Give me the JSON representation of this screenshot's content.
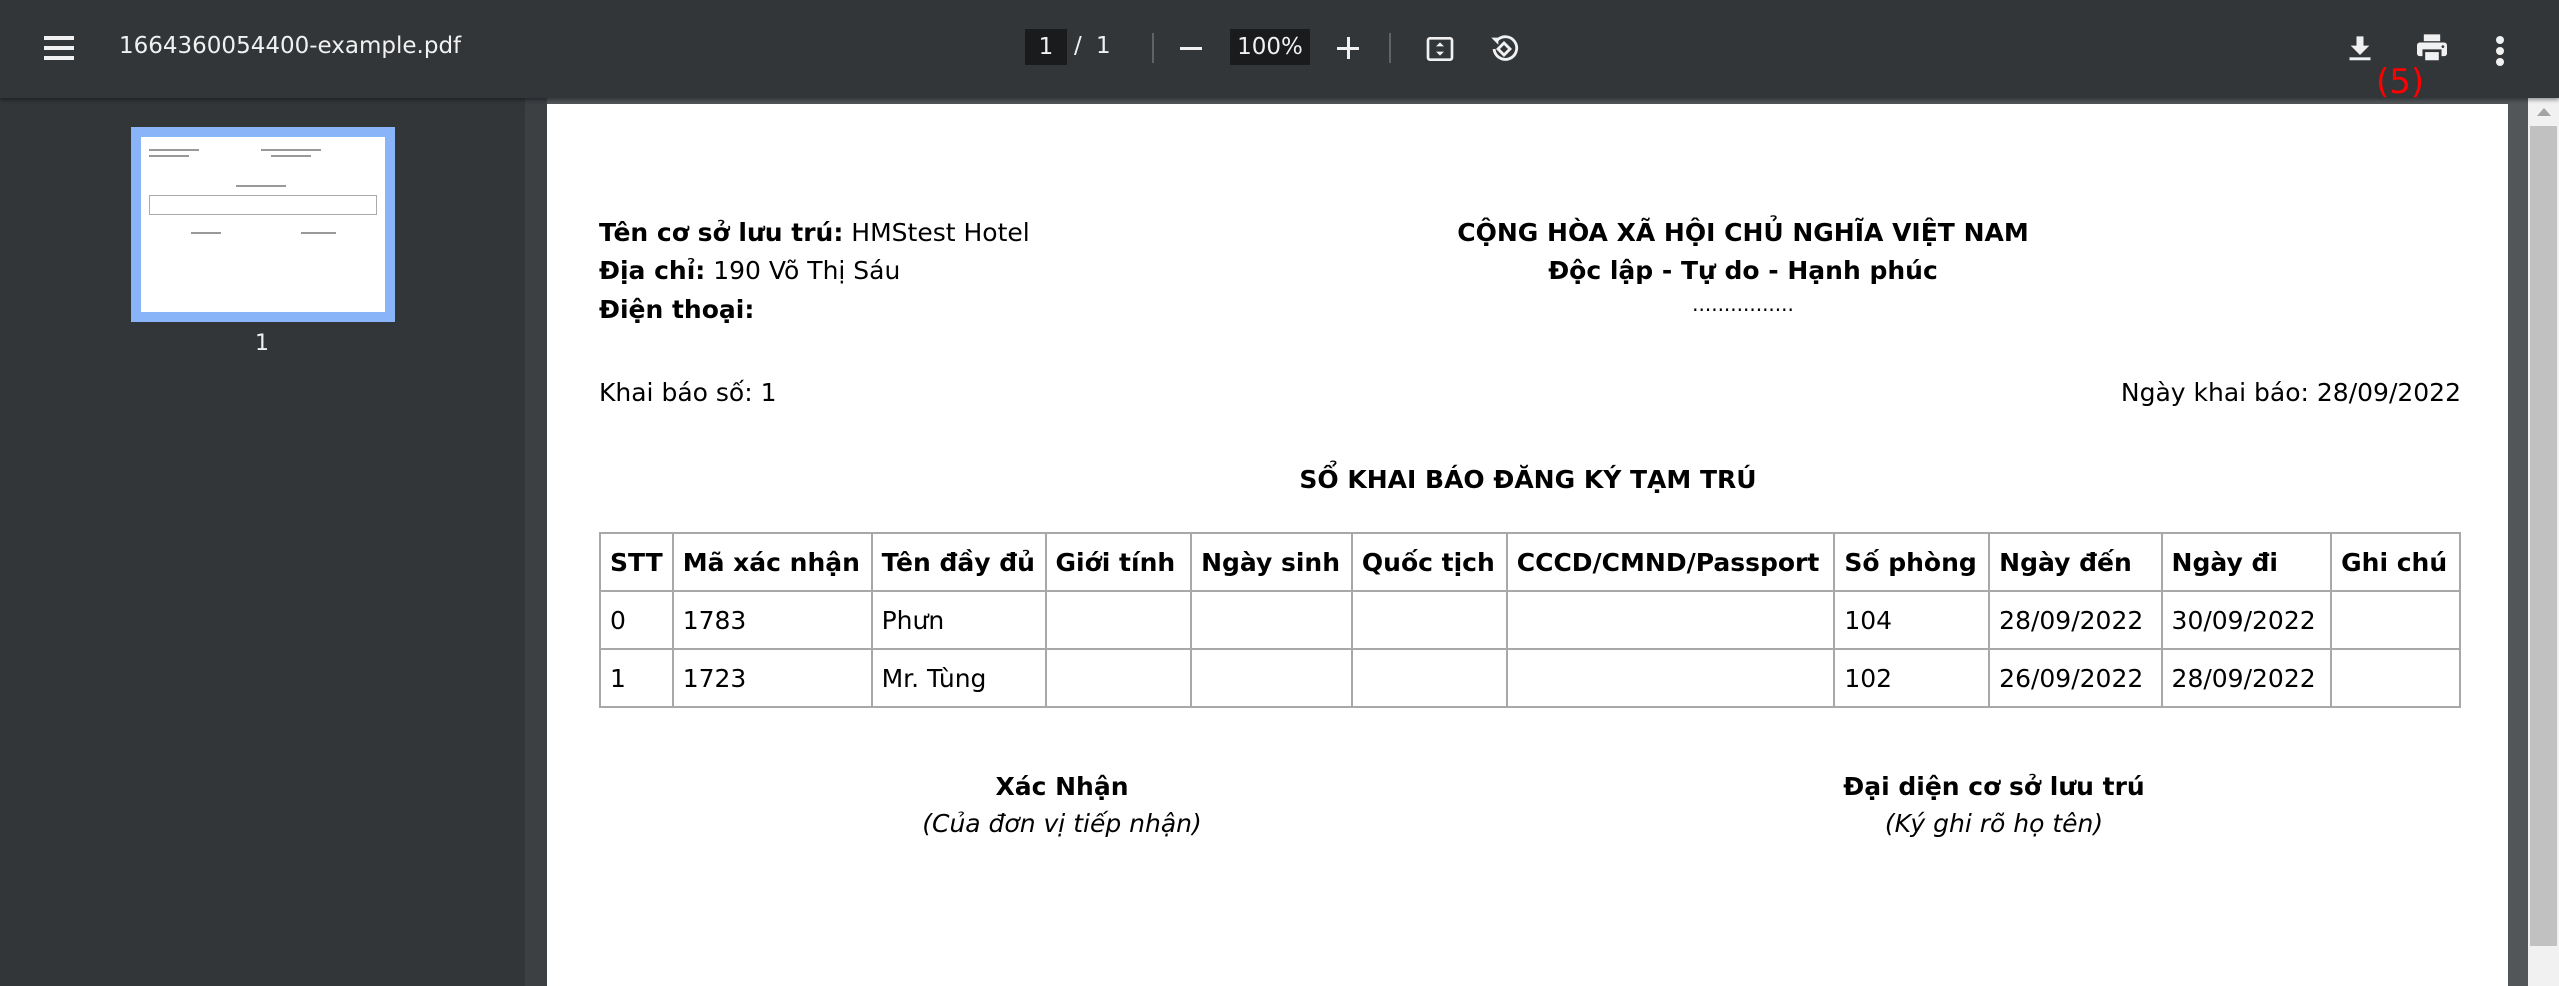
{
  "toolbar": {
    "filename": "1664360054400-example.pdf",
    "page_current": "1",
    "page_sep": "/",
    "page_total": "1",
    "zoom": "100%",
    "annotation": "(5)",
    "annotation_color": "#ff0000"
  },
  "sidebar": {
    "thumbnails": [
      {
        "label": "1"
      }
    ]
  },
  "document": {
    "left_header": [
      {
        "label": "Tên cơ sở lưu trú:",
        "value": "HMStest Hotel"
      },
      {
        "label": "Địa chỉ:",
        "value": "190 Võ Thị Sáu"
      },
      {
        "label": "Điện thoại:",
        "value": ""
      }
    ],
    "right_header": {
      "line1": "CỘNG HÒA XÃ HỘI CHỦ NGHĨA VIỆT NAM",
      "line2": "Độc lập - Tự do - Hạnh phúc",
      "line3": "................"
    },
    "declaration_no": "Khai báo số: 1",
    "declaration_date": "Ngày khai báo: 28/09/2022",
    "title": "SỔ KHAI BÁO ĐĂNG KÝ TẠM TRÚ",
    "table": {
      "headers": [
        "STT",
        "Mã xác nhận",
        "Tên đầy đủ",
        "Giới tính",
        "Ngày sinh",
        "Quốc tịch",
        "CCCD/CMND/Passport",
        "Số phòng",
        "Ngày đến",
        "Ngày đi",
        "Ghi chú"
      ],
      "rows": [
        [
          "0",
          "1783",
          "Phưn",
          "",
          "",
          "",
          "",
          "104",
          "28/09/2022",
          "30/09/2022",
          ""
        ],
        [
          "1",
          "1723",
          "Mr. Tùng",
          "",
          "",
          "",
          "",
          "102",
          "26/09/2022",
          "28/09/2022",
          ""
        ]
      ]
    },
    "sign_left": {
      "title": "Xác Nhận",
      "subtitle": "(Của đơn vị tiếp nhận)"
    },
    "sign_right": {
      "title": "Đại diện cơ sở lưu trú",
      "subtitle": "(Ký ghi rõ họ tên)"
    }
  }
}
